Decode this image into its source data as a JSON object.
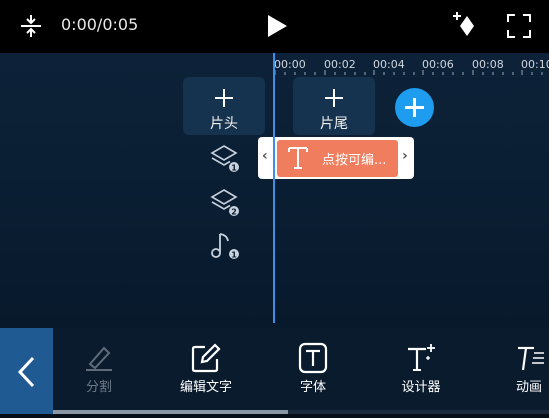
{
  "topbar": {
    "time": "0:00/0:05",
    "icons": [
      "split-icon",
      "play-icon",
      "magic-sparkle-icon",
      "fullscreen-icon"
    ]
  },
  "ruler": {
    "ticks": [
      "00:00",
      "00:02",
      "00:04",
      "00:06",
      "00:08",
      "00:10"
    ]
  },
  "tiles": {
    "intro_label": "片头",
    "outro_label": "片尾"
  },
  "tracks": {
    "layer1_badge": "1",
    "layer2_badge": "2",
    "music_badge": "1"
  },
  "clip": {
    "text": "点按可编..."
  },
  "toolbar": {
    "tools": [
      {
        "label": "分割",
        "icon": "eraser-pen-icon",
        "enabled": false
      },
      {
        "label": "编辑文字",
        "icon": "edit-square-icon",
        "enabled": true
      },
      {
        "label": "字体",
        "icon": "font-t-icon",
        "enabled": true
      },
      {
        "label": "设计器",
        "icon": "text-designer-icon",
        "enabled": true
      },
      {
        "label": "动画",
        "icon": "text-animation-icon",
        "enabled": true
      }
    ]
  },
  "colors": {
    "accent": "#1e9cf0",
    "clip": "#f07d5e",
    "playhead": "#3d8fe8",
    "back_button": "#1f5a92"
  }
}
